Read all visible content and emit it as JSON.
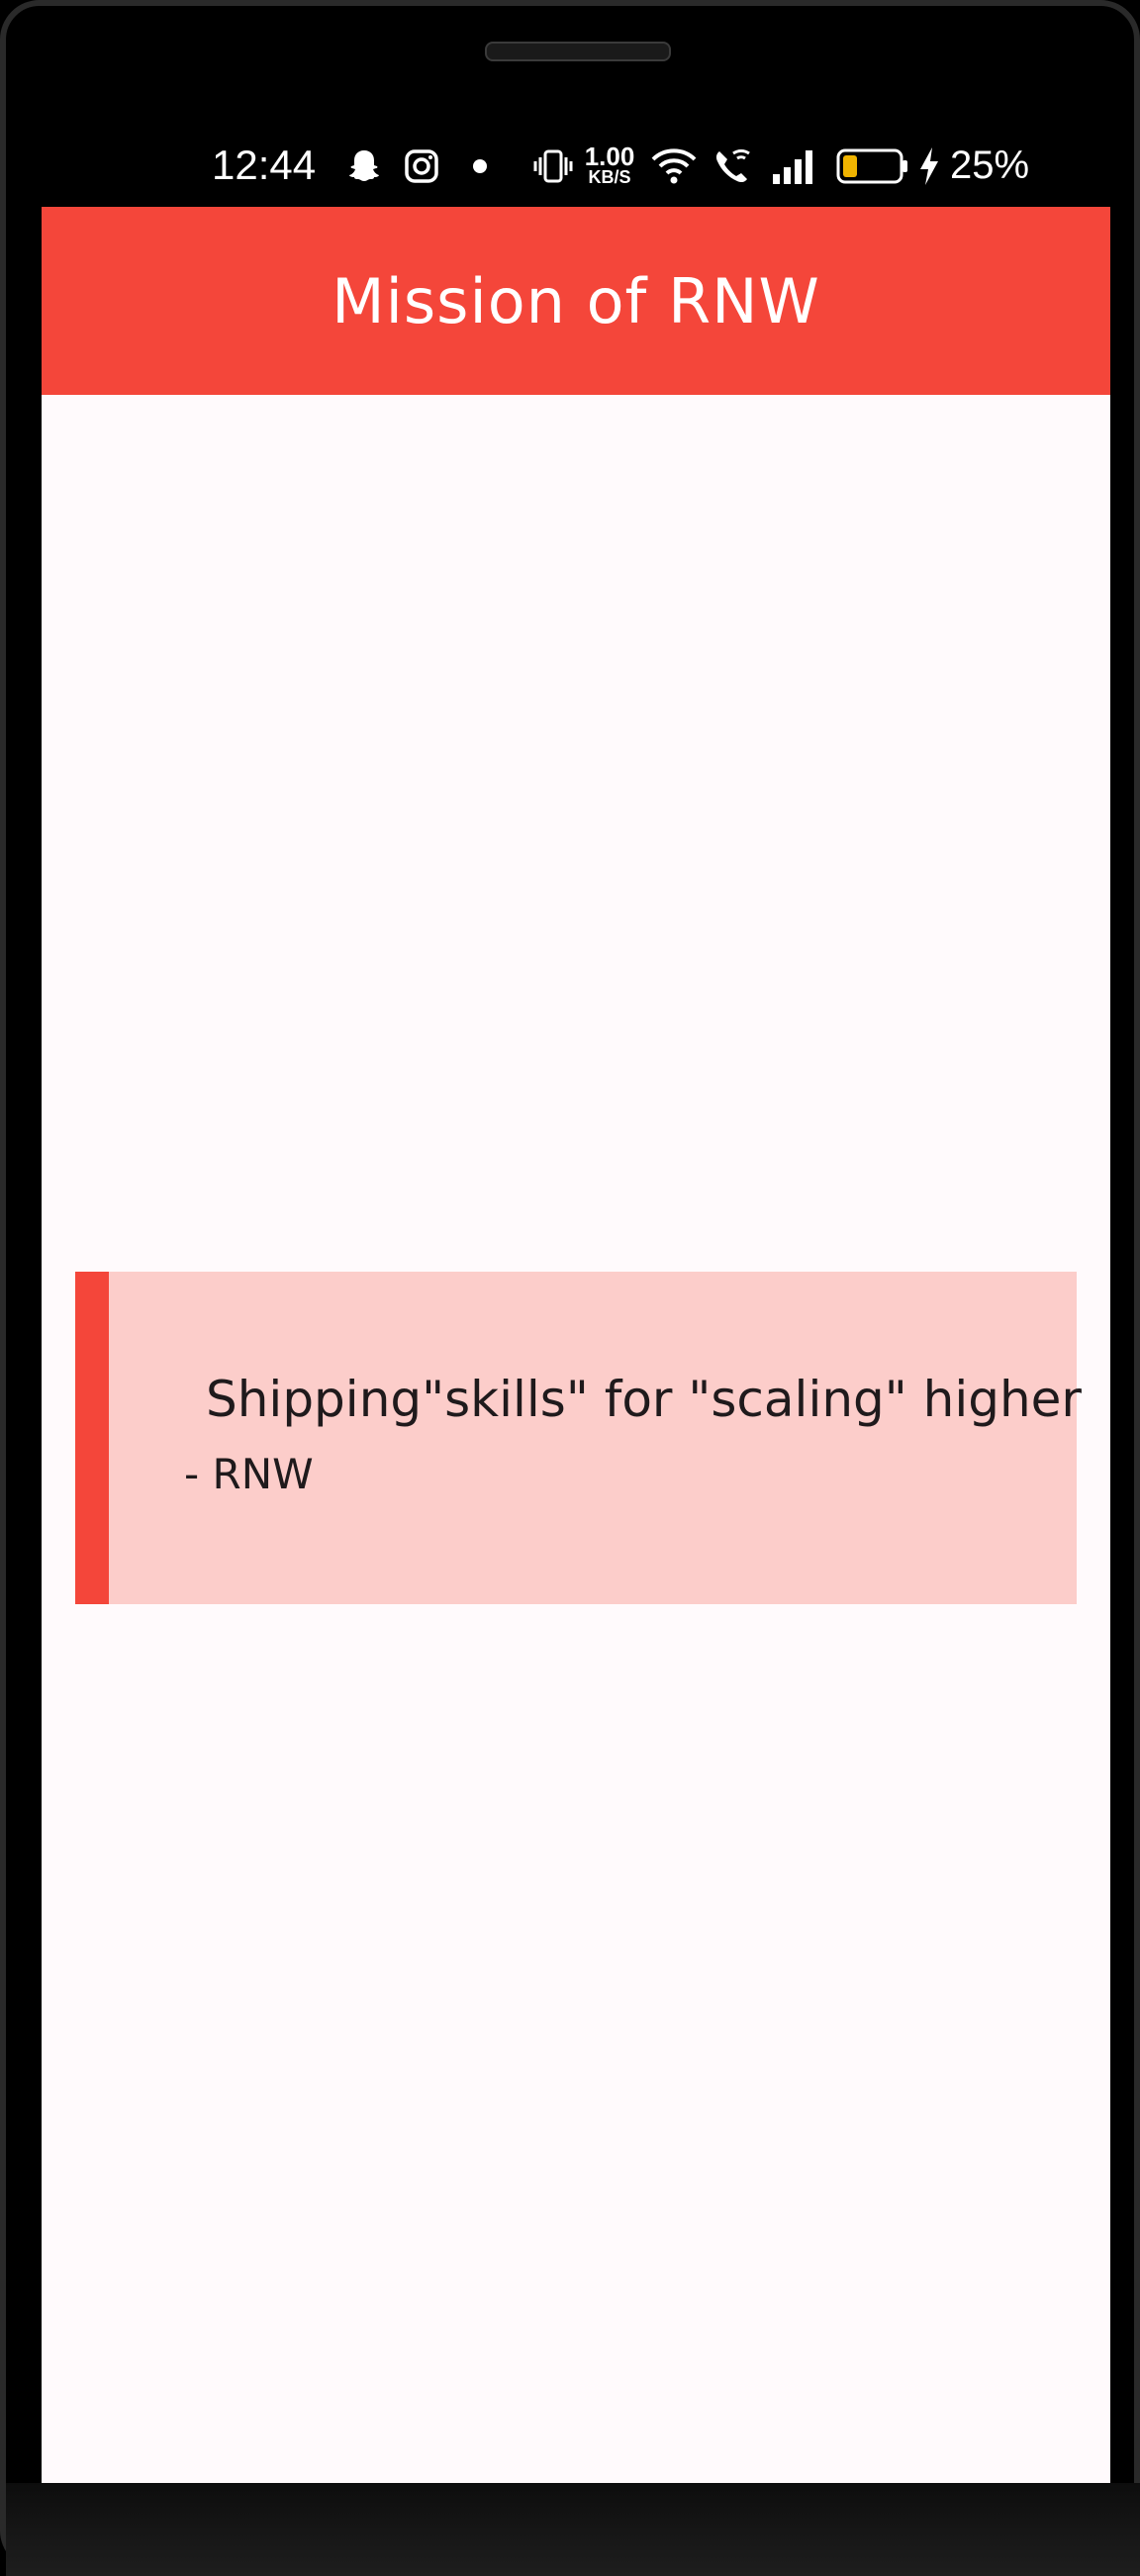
{
  "status_bar": {
    "time": "12:44",
    "net_speed_value": "1.00",
    "net_speed_unit": "KB/S",
    "battery_percent": "25%",
    "icons": [
      "snapchat-icon",
      "instagram-icon",
      "dot-icon",
      "vibrate-icon",
      "wifi-icon",
      "wifi-calling-icon",
      "signal-icon",
      "battery-icon",
      "charging-icon"
    ],
    "battery_level": 0.25,
    "battery_fill_color": "#f0b400"
  },
  "app_bar": {
    "title": "Mission of RNW",
    "color": "#f4463a"
  },
  "quote": {
    "text": "Shipping\"skills\" for \"scaling\" higher",
    "author": "- RNW",
    "background_color": "#fccdca",
    "accent_color": "#f4463a"
  }
}
